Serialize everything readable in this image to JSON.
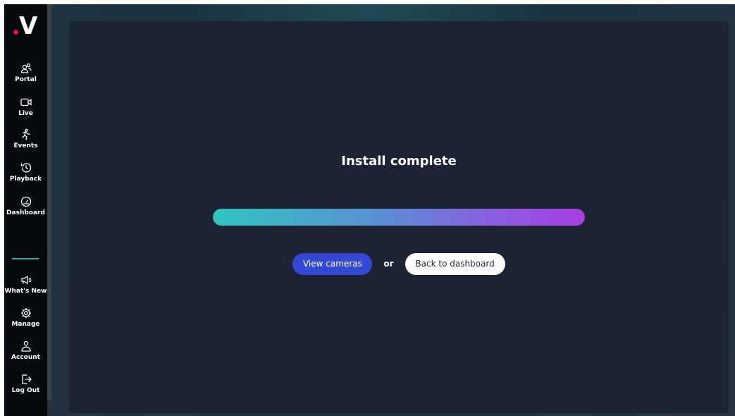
{
  "sidebar": {
    "logo_text": "V",
    "items": [
      {
        "label": "Portal",
        "icon": "people-icon"
      },
      {
        "label": "Live",
        "icon": "video-camera-icon"
      },
      {
        "label": "Events",
        "icon": "running-person-icon"
      },
      {
        "label": "Playback",
        "icon": "history-icon"
      },
      {
        "label": "Dashboard",
        "icon": "gauge-icon"
      }
    ],
    "bottom_items": [
      {
        "label": "What's New",
        "icon": "megaphone-icon"
      },
      {
        "label": "Manage",
        "icon": "gear-icon"
      },
      {
        "label": "Account",
        "icon": "user-icon"
      },
      {
        "label": "Log Out",
        "icon": "logout-icon"
      }
    ]
  },
  "main": {
    "title": "Install complete",
    "progress": 1.0,
    "primary_button": "View cameras",
    "separator": "or",
    "secondary_button": "Back to dashboard"
  },
  "colors": {
    "accent": "#3448d6",
    "brand_red": "#e4163a",
    "divider": "#2fa7a1",
    "gradient_start": "#2fc6be",
    "gradient_end": "#a83fe3"
  }
}
